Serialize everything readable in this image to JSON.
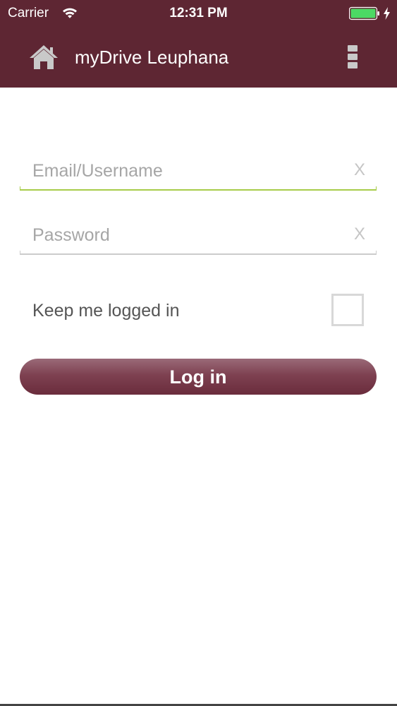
{
  "status_bar": {
    "carrier": "Carrier",
    "time": "12:31 PM",
    "battery_color": "#4cd964"
  },
  "nav": {
    "title": "myDrive Leuphana",
    "home_icon": "home-icon",
    "menu_icon": "more-vertical-icon",
    "background": "#5e2633"
  },
  "login_form": {
    "email_placeholder": "Email/Username",
    "email_value": "",
    "password_placeholder": "Password",
    "password_value": "",
    "clear_label": "X",
    "keep_logged_in_label": "Keep me logged in",
    "keep_logged_in_checked": false,
    "login_label": "Log in",
    "active_field_color": "#a7cc4a",
    "button_color": "#7e4151"
  }
}
